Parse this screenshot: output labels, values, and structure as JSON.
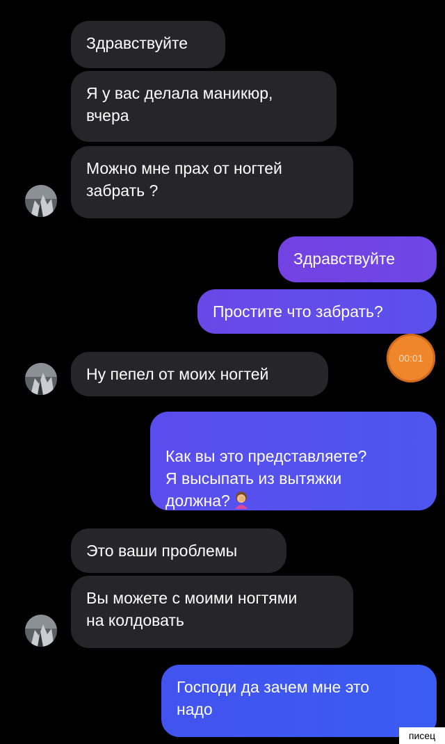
{
  "messages": [
    {
      "side": "incoming",
      "text": "Здравствуйте"
    },
    {
      "side": "incoming",
      "text": "Я у вас делала маникюр,\nвчера"
    },
    {
      "side": "incoming",
      "text": "Можно мне прах от ногтей\nзабрать ?"
    },
    {
      "side": "outgoing",
      "text": "Здравствуйте"
    },
    {
      "side": "outgoing",
      "text": "Простите что забрать?"
    },
    {
      "side": "incoming",
      "text": "Ну пепел от моих ногтей"
    },
    {
      "side": "outgoing",
      "text": "Как вы это представляете?\nЯ высыпать из вытяжки\nдолжна?",
      "emoji": "woman-facepalming"
    },
    {
      "side": "incoming",
      "text": "Это ваши проблемы"
    },
    {
      "side": "incoming",
      "text": "Вы можете с моими ногтями\nна колдовать"
    },
    {
      "side": "outgoing",
      "text": "Господи да зачем мне это\nнадо"
    }
  ],
  "timer": {
    "label": "00:01"
  },
  "watermark": {
    "text": "писец"
  },
  "colors": {
    "background": "#000000",
    "incoming_bubble": "#262628",
    "outgoing_gradient_start": "#7a3fe0",
    "outgoing_gradient_end": "#3d5af0",
    "timer": "#f0862c"
  },
  "icons": {
    "avatar": "user-avatar-icon",
    "emoji": "woman-facepalming-icon"
  }
}
